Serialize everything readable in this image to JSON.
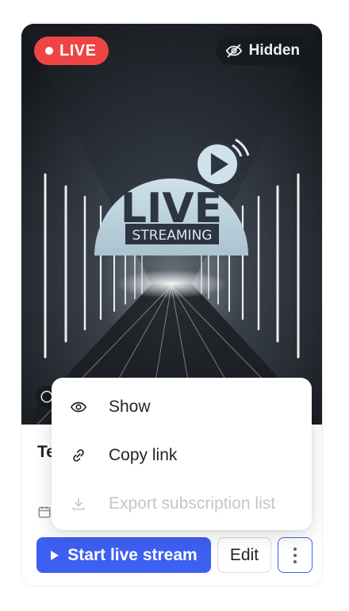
{
  "stream_card": {
    "live_badge": "LIVE",
    "visibility_badge": "Hidden",
    "thumbnail": {
      "headline": "LIVE",
      "subheadline": "STREAMING"
    },
    "title": "Te"
  },
  "actions": {
    "start_label": "Start live stream",
    "edit_label": "Edit"
  },
  "context_menu": {
    "items": [
      {
        "label": "Show",
        "icon": "eye-icon",
        "enabled": true
      },
      {
        "label": "Copy link",
        "icon": "link-icon",
        "enabled": true
      },
      {
        "label": "Export subscription list",
        "icon": "download-icon",
        "enabled": false
      }
    ]
  },
  "colors": {
    "accent": "#3d5ff2",
    "live_red": "#ef4444",
    "disabled_text": "#c2c6cc"
  }
}
